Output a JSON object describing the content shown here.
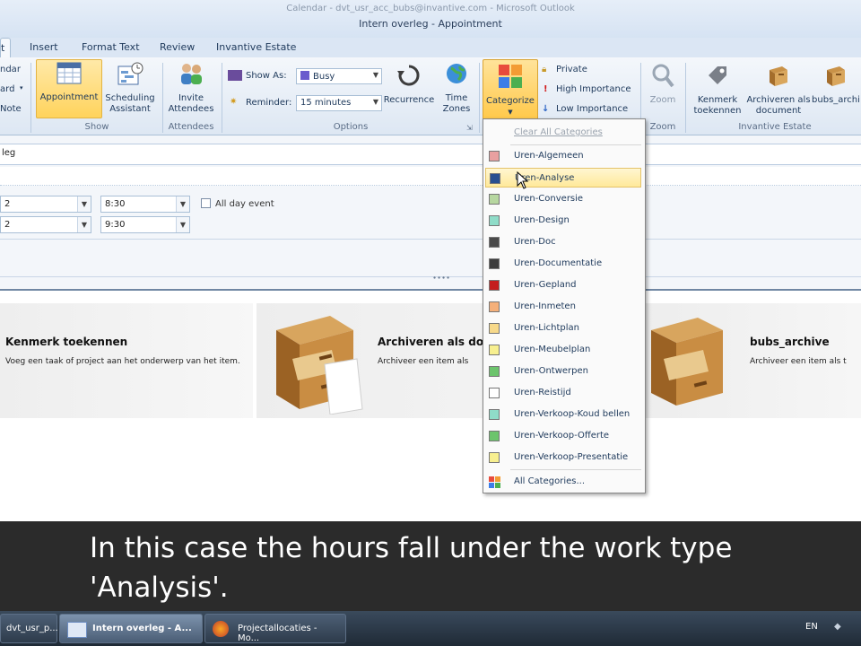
{
  "window": {
    "title_faded": "Calendar - dvt_usr_acc_bubs@invantive.com - Microsoft Outlook",
    "title": "Intern overleg - Appointment"
  },
  "tabs": [
    "t",
    "Insert",
    "Format Text",
    "Review",
    "Invantive Estate"
  ],
  "ribbon": {
    "actions_partial": [
      "ndar",
      "ard",
      "Note"
    ],
    "show": {
      "appointment": "Appointment",
      "scheduling": "Scheduling Assistant",
      "group": "Show"
    },
    "attendees": {
      "invite": "Invite Attendees",
      "group": "Attendees"
    },
    "options": {
      "show_as_label": "Show As:",
      "show_as_value": "Busy",
      "reminder_label": "Reminder:",
      "reminder_value": "15 minutes",
      "recurrence": "Recurrence",
      "time_zones": "Time Zones",
      "group": "Options"
    },
    "tags": {
      "categorize": "Categorize",
      "private": "Private",
      "high": "High Importance",
      "low": "Low Importance"
    },
    "zoom": {
      "zoom": "Zoom",
      "group": "Zoom"
    },
    "invantive": {
      "kenmerk": "Kenmerk toekennen",
      "archiveren": "Archiveren als document",
      "bubs": "bubs_archi",
      "group": "Invantive Estate"
    }
  },
  "form": {
    "subject": "leg",
    "start_date": "2",
    "start_time": "8:30",
    "end_date": "2",
    "end_time": "9:30",
    "all_day": "All day event"
  },
  "cards": [
    {
      "title": "Kenmerk toekennen",
      "desc": "Voeg een taak of project aan het onderwerp van het item."
    },
    {
      "title": "Archiveren als doc",
      "desc": "Archiveer een item als"
    },
    {
      "title": "bubs_archive",
      "desc": "Archiveer een item als t"
    }
  ],
  "categories_menu": {
    "clear": "Clear All Categories",
    "items": [
      {
        "label": "Uren-Algemeen",
        "color": "#e8a0a0"
      },
      {
        "label": "Uren-Analyse",
        "color": "#2a4f8f",
        "highlighted": true
      },
      {
        "label": "Uren-Conversie",
        "color": "#b7d7a0"
      },
      {
        "label": "Uren-Design",
        "color": "#8fdcc8"
      },
      {
        "label": "Uren-Doc",
        "color": "#4a4a4a"
      },
      {
        "label": "Uren-Documentatie",
        "color": "#3c3c3c"
      },
      {
        "label": "Uren-Gepland",
        "color": "#c41e1e"
      },
      {
        "label": "Uren-Inmeten",
        "color": "#f5b07a"
      },
      {
        "label": "Uren-Lichtplan",
        "color": "#f7d98a"
      },
      {
        "label": "Uren-Meubelplan",
        "color": "#f7ef8f"
      },
      {
        "label": "Uren-Ontwerpen",
        "color": "#6cc46c"
      },
      {
        "label": "Uren-Reistijd",
        "color": "#ffffff"
      },
      {
        "label": "Uren-Verkoop-Koud bellen",
        "color": "#8fdcc8"
      },
      {
        "label": "Uren-Verkoop-Offerte",
        "color": "#6cc46c"
      },
      {
        "label": "Uren-Verkoop-Presentatie",
        "color": "#f7ef8f"
      }
    ],
    "all": "All Categories..."
  },
  "caption": "In this case the hours fall under the work type 'Analysis'.",
  "taskbar": {
    "items": [
      "dvt_usr_p...",
      "Intern overleg - A...",
      "Projectallocaties - Mo..."
    ],
    "lang": "EN"
  }
}
